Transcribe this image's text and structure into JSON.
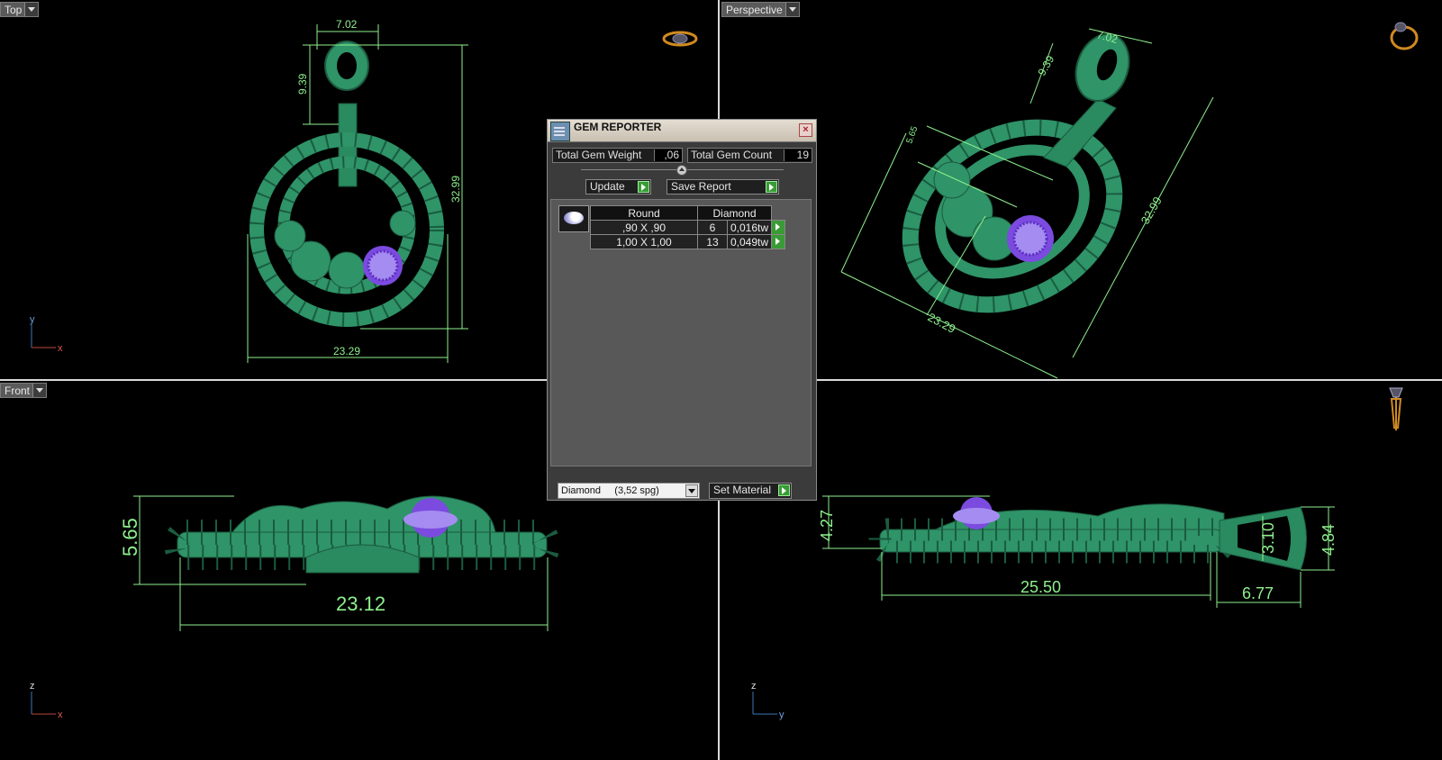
{
  "viewports": {
    "top": {
      "label": "Top",
      "axis_v": "y",
      "axis_h": "x",
      "dims": {
        "loop_width": "7.02",
        "loop_height": "9.39",
        "height": "32.99",
        "width": "23.29"
      }
    },
    "perspective": {
      "label": "Perspective",
      "dims": {
        "loop_width": "7.02",
        "loop_height": "9.39",
        "height": "32.99",
        "width": "23.29",
        "side": "5.65"
      }
    },
    "front": {
      "label": "Front",
      "axis_v": "z",
      "axis_h": "x",
      "dims": {
        "height": "5.65",
        "width": "23.12"
      }
    },
    "side": {
      "axis_v": "z",
      "axis_h": "y",
      "dims": {
        "height": "4.27",
        "bail_inner": "3.10",
        "bail_outer": "4.84",
        "length": "25.50",
        "bail_length": "6.77"
      }
    }
  },
  "gem_reporter": {
    "title": "GEM REPORTER",
    "total_weight_label": "Total Gem Weight",
    "total_weight_value": ",06",
    "total_count_label": "Total Gem Count",
    "total_count_value": "19",
    "update_label": "Update",
    "save_report_label": "Save Report",
    "table": {
      "shape": "Round",
      "material": "Diamond",
      "rows": [
        {
          "size": ",90 X ,90",
          "count": "6",
          "weight": "0,016tw"
        },
        {
          "size": "1,00 X 1,00",
          "count": "13",
          "weight": "0,049tw"
        }
      ]
    },
    "material_select": "Diamond     (3,52 spg)",
    "set_material_label": "Set Material",
    "close_glyph": "×"
  }
}
